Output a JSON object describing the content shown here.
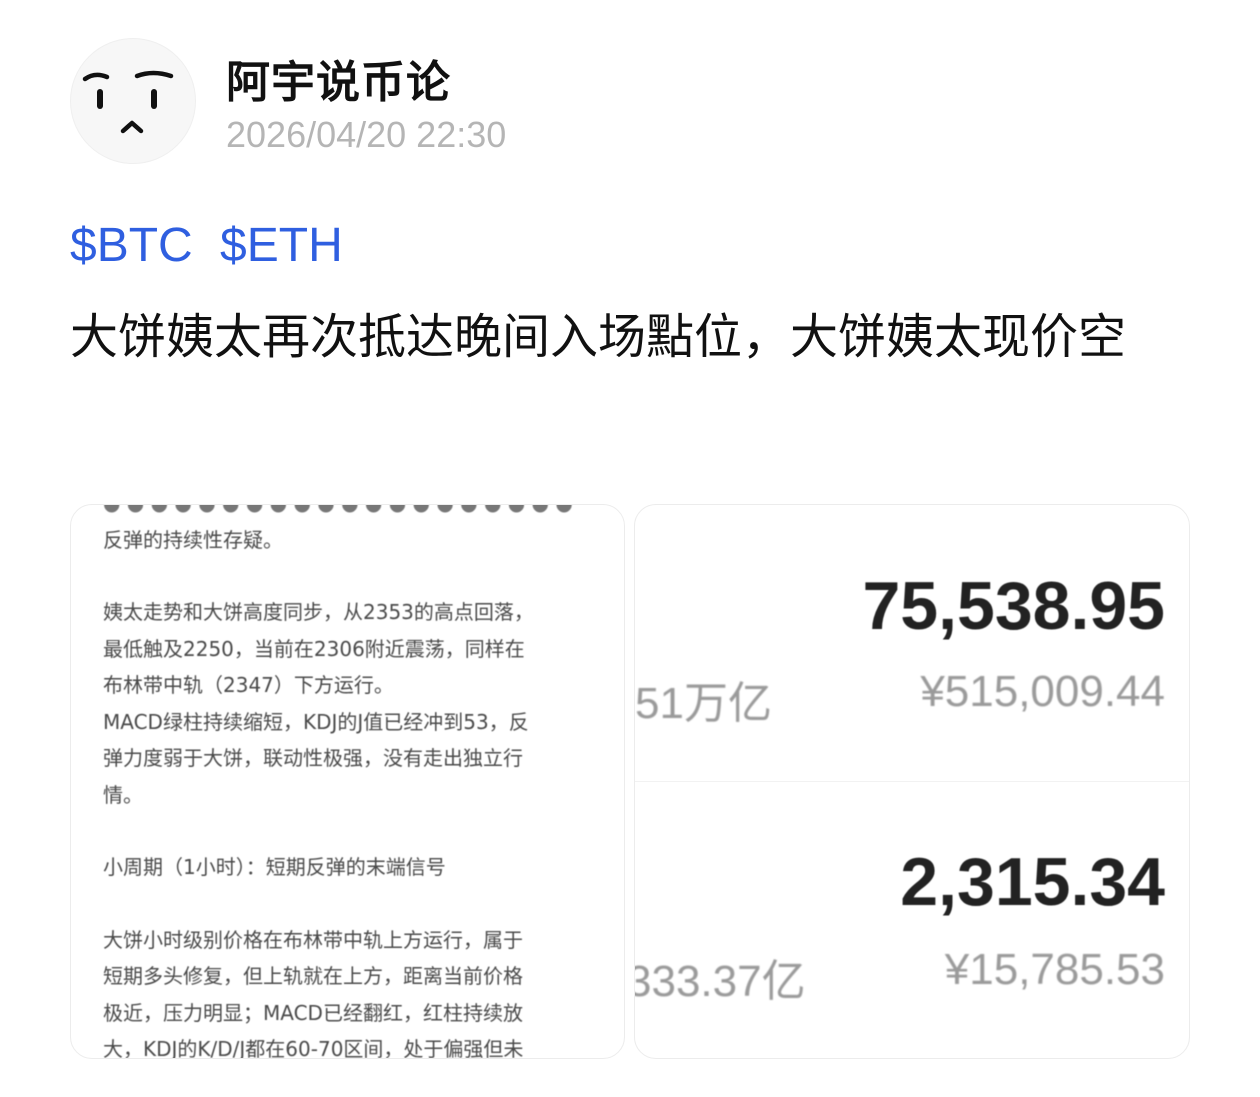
{
  "post": {
    "author": "阿宇说币论",
    "timestamp": "2026/04/20 22:30",
    "avatar_icon": "frown-face-avatar-icon",
    "tags": [
      "$BTC",
      "$ETH"
    ],
    "tag_color": "#2f5fe0",
    "text": "大饼姨太再次抵达晚间入场點位，大饼姨太现价空"
  },
  "images": {
    "analysis_doc": {
      "lines": [
        "反弹的持续性存疑。",
        "",
        "姨太走势和大饼高度同步，从2353的高点回落，",
        "最低触及2250，当前在2306附近震荡，同样在",
        "布林带中轨（2347）下方运行。",
        "MACD绿柱持续缩短，KDJ的J值已经冲到53，反",
        "弹力度弱于大饼，联动性极强，没有走出独立行",
        "情。",
        "",
        "小周期（1小时）：短期反弹的末端信号",
        "",
        "大饼小时级别价格在布林带中轨上方运行，属于",
        "短期多头修复，但上轨就在上方，距离当前价格",
        "极近，压力明显；MACD已经翻红，红柱持续放",
        "大，KDJ的K/D/J都在60-70区间，处于偏强但未"
      ]
    },
    "quotes": [
      {
        "price": "75,538.95",
        "market_cap": "51万亿",
        "cny_price": "¥515,009.44"
      },
      {
        "price": "2,315.34",
        "market_cap": "333.37亿",
        "cny_price": "¥15,785.53"
      }
    ]
  }
}
